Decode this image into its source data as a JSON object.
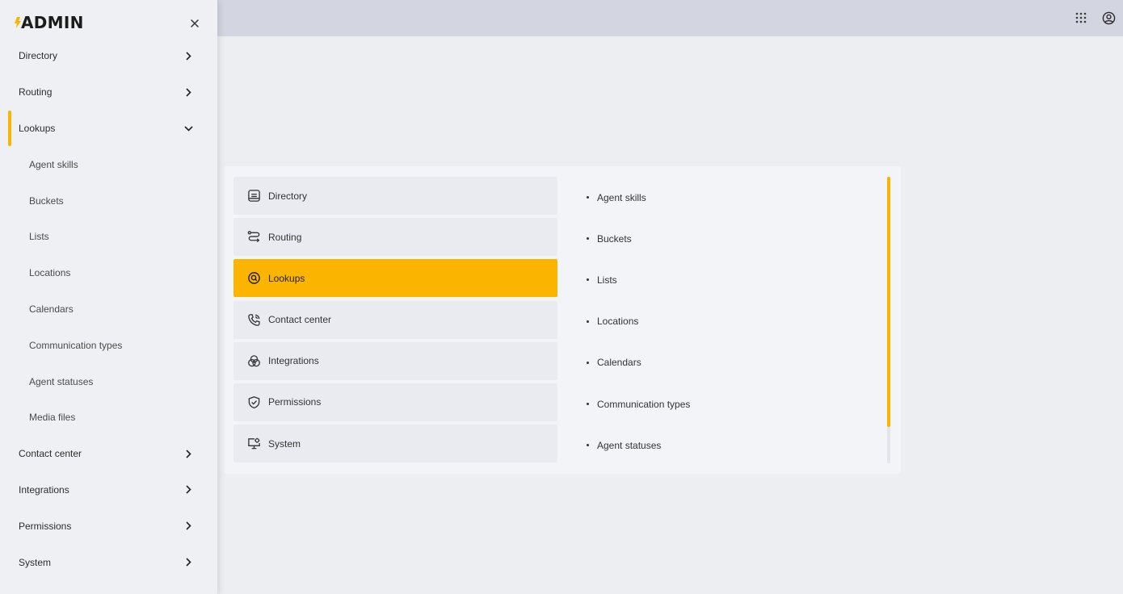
{
  "colors": {
    "accent": "#fbb400",
    "sidebar_bg": "#eef0f4",
    "topbar_bg": "#d3d6e0",
    "page_bg": "#edeef2"
  },
  "topbar": {
    "icons": [
      "apps-grid-icon",
      "account-circle-icon"
    ]
  },
  "sidebar": {
    "logo_text": "ADMIN",
    "close_icon": "close-icon",
    "items": [
      {
        "label": "Directory",
        "state": "collapsed"
      },
      {
        "label": "Routing",
        "state": "collapsed"
      },
      {
        "label": "Lookups",
        "state": "expanded"
      },
      {
        "label": "Contact center",
        "state": "collapsed"
      },
      {
        "label": "Integrations",
        "state": "collapsed"
      },
      {
        "label": "Permissions",
        "state": "collapsed"
      },
      {
        "label": "System",
        "state": "collapsed"
      }
    ],
    "lookups_children": [
      "Agent skills",
      "Buckets",
      "Lists",
      "Locations",
      "Calendars",
      "Communication types",
      "Agent statuses",
      "Media files"
    ]
  },
  "main": {
    "categories": [
      {
        "label": "Directory",
        "icon": "directory-icon"
      },
      {
        "label": "Routing",
        "icon": "routing-icon"
      },
      {
        "label": "Lookups",
        "icon": "lookups-icon",
        "selected": true
      },
      {
        "label": "Contact center",
        "icon": "phone-icon"
      },
      {
        "label": "Integrations",
        "icon": "integrations-icon"
      },
      {
        "label": "Permissions",
        "icon": "shield-check-icon"
      },
      {
        "label": "System",
        "icon": "monitor-gear-icon"
      }
    ],
    "subitems": [
      "Agent skills",
      "Buckets",
      "Lists",
      "Locations",
      "Calendars",
      "Communication types",
      "Agent statuses"
    ],
    "scroll_position": 0,
    "scroll_visible_fraction": 0.87
  }
}
